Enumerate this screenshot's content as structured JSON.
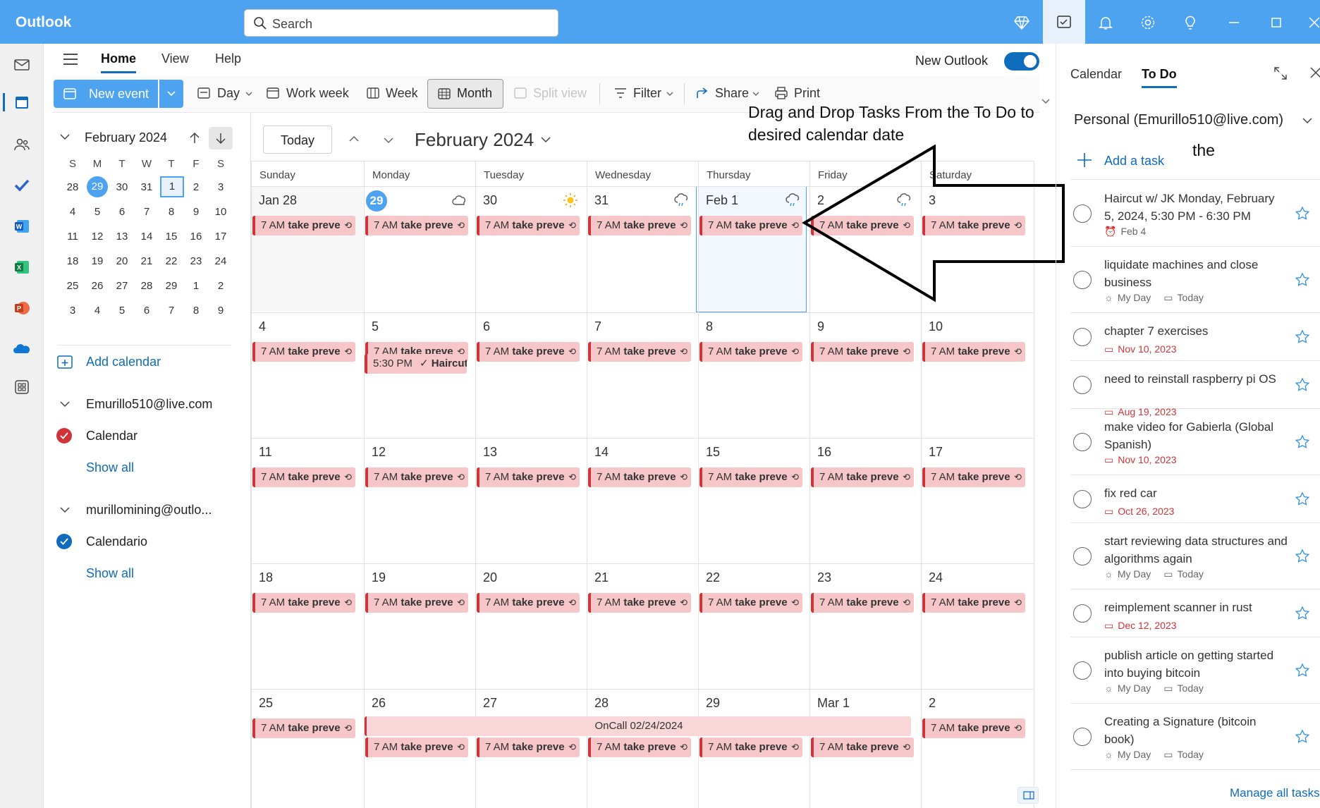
{
  "app": {
    "title": "Outlook",
    "search_placeholder": "Search"
  },
  "ribbon": {
    "tabs": [
      "Home",
      "View",
      "Help"
    ],
    "new_outlook_label": "New Outlook",
    "new_event": "New event",
    "day": "Day",
    "work_week": "Work week",
    "week": "Week",
    "month": "Month",
    "split_view": "Split view",
    "filter": "Filter",
    "share": "Share",
    "print": "Print"
  },
  "annotation": {
    "line1": "Drag and Drop Tasks From the To Do to",
    "line2": "desired calendar date",
    "stray": "the"
  },
  "mini_calendar": {
    "title": "February 2024",
    "dow": [
      "S",
      "M",
      "T",
      "W",
      "T",
      "F",
      "S"
    ],
    "weeks": [
      [
        "28",
        "29",
        "30",
        "31",
        "1",
        "2",
        "3"
      ],
      [
        "4",
        "5",
        "6",
        "7",
        "8",
        "9",
        "10"
      ],
      [
        "11",
        "12",
        "13",
        "14",
        "15",
        "16",
        "17"
      ],
      [
        "18",
        "19",
        "20",
        "21",
        "22",
        "23",
        "24"
      ],
      [
        "25",
        "26",
        "27",
        "28",
        "29",
        "1",
        "2"
      ],
      [
        "3",
        "4",
        "5",
        "6",
        "7",
        "8",
        "9"
      ]
    ]
  },
  "sidebar": {
    "add_calendar": "Add calendar",
    "accounts": [
      {
        "email": "Emurillo510@live.com",
        "calendar": "Calendar",
        "show_all": "Show all",
        "color": "#d13438"
      },
      {
        "email": "murillomining@outlo...",
        "calendar": "Calendario",
        "show_all": "Show all",
        "color": "#0f6cbd"
      }
    ]
  },
  "calendar": {
    "today_button": "Today",
    "title": "February 2024",
    "dow": [
      "Sunday",
      "Monday",
      "Tuesday",
      "Wednesday",
      "Thursday",
      "Friday",
      "Saturday"
    ],
    "weeks": [
      [
        "Jan 28",
        "29",
        "30",
        "31",
        "Feb 1",
        "2",
        "3"
      ],
      [
        "4",
        "5",
        "6",
        "7",
        "8",
        "9",
        "10"
      ],
      [
        "11",
        "12",
        "13",
        "14",
        "15",
        "16",
        "17"
      ],
      [
        "18",
        "19",
        "20",
        "21",
        "22",
        "23",
        "24"
      ],
      [
        "25",
        "26",
        "27",
        "28",
        "29",
        "Mar 1",
        "2"
      ]
    ],
    "recurring_time": "7 AM",
    "recurring_title": "take preve",
    "haircut_time": "5:30 PM",
    "haircut_title": "Haircut",
    "oncall": "OnCall 02/24/2024"
  },
  "todo": {
    "tabs": [
      "Calendar",
      "To Do"
    ],
    "list_name": "Personal (Emurillo510@live.com)",
    "add_task": "Add a task",
    "manage": "Manage all tasks",
    "tasks": [
      {
        "title": "Haircut w/ JK Monday, February 5, 2024, 5:30 PM - 6:30 PM",
        "meta": [
          "Feb 4"
        ],
        "red": false,
        "alarm": true
      },
      {
        "title": "liquidate machines and close business",
        "meta": [
          "My Day",
          "Today"
        ],
        "red": false
      },
      {
        "title": "chapter 7 exercises",
        "meta": [
          "Nov 10, 2023"
        ],
        "red": true
      },
      {
        "title": "need to reinstall raspberry pi OS",
        "meta": [
          "Aug 19, 2023"
        ],
        "red": true
      },
      {
        "title": "make video for Gabierla (Global Spanish)",
        "meta": [
          "Nov 10, 2023"
        ],
        "red": true
      },
      {
        "title": "fix red car",
        "meta": [
          "Oct 26, 2023"
        ],
        "red": true
      },
      {
        "title": "start reviewing data structures and algorithms again",
        "meta": [
          "My Day",
          "Today"
        ],
        "red": false
      },
      {
        "title": "reimplement scanner in rust",
        "meta": [
          "Dec 12, 2023"
        ],
        "red": true
      },
      {
        "title": "publish article on getting started into buying bitcoin",
        "meta": [
          "My Day",
          "Today"
        ],
        "red": false
      },
      {
        "title": "Creating a Signature (bitcoin book)",
        "meta": [
          "My Day",
          "Today"
        ],
        "red": false
      }
    ]
  },
  "colors": {
    "accent": "#4da3f0",
    "brand": "#0f6cbd",
    "event_bg": "#f6c6c8",
    "event_border": "#d13438"
  }
}
